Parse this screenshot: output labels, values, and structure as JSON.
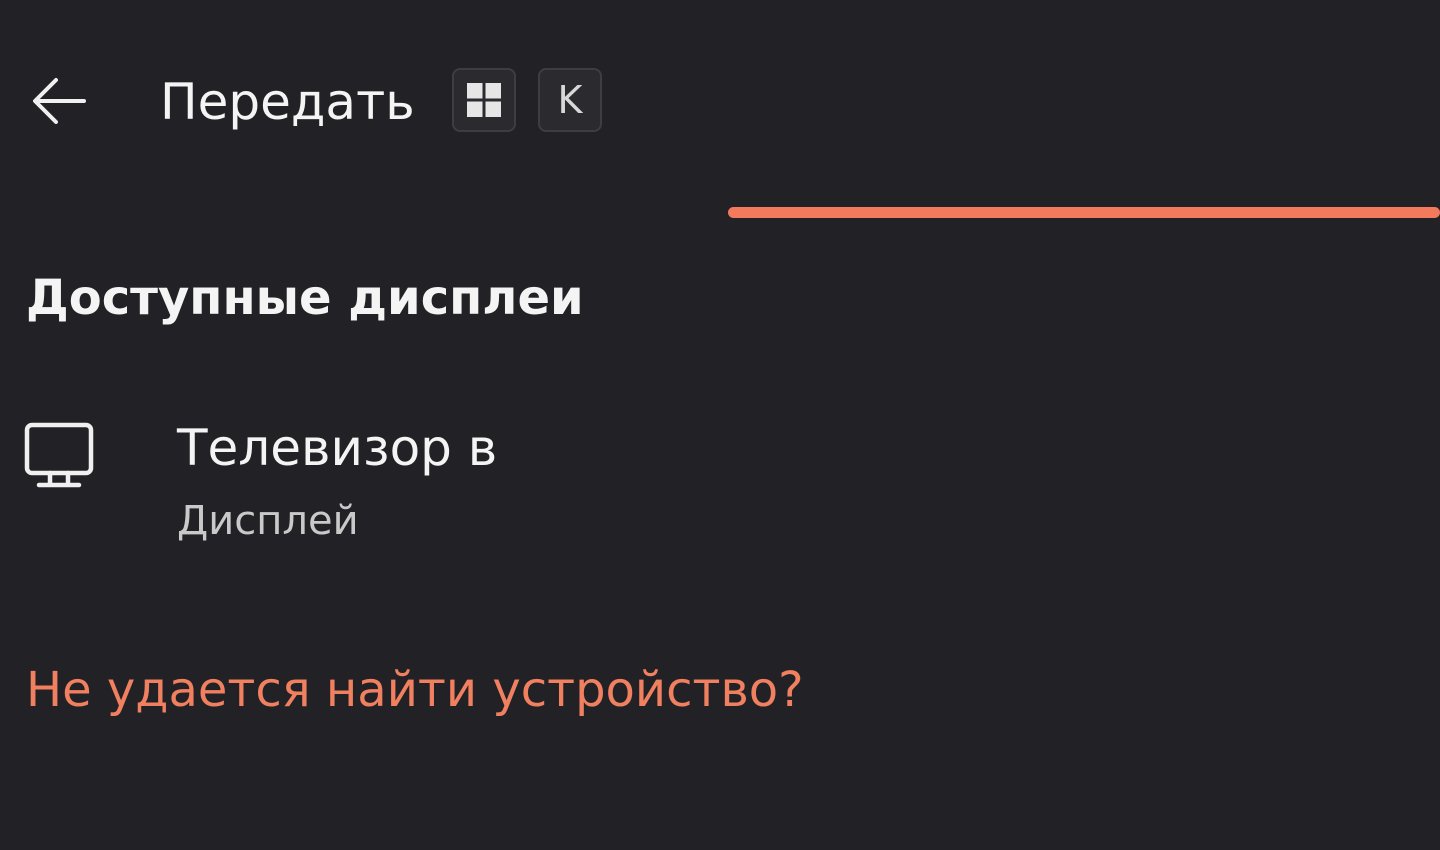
{
  "header": {
    "back_icon": "arrow-left-icon",
    "title": "Передать",
    "shortcut": {
      "win_key_icon": "windows-logo-icon",
      "key": "K"
    }
  },
  "progress": {
    "state": "indeterminate",
    "color": "#f47a5e"
  },
  "section": {
    "title": "Доступные дисплеи"
  },
  "devices": [
    {
      "icon": "monitor-icon",
      "name": "Телевизор в",
      "type": "Дисплей"
    }
  ],
  "help_link": {
    "label": "Не удается найти устройство?",
    "color": "#f0805f"
  },
  "colors": {
    "background": "#222226",
    "text": "#f4f4f4",
    "subtext": "#c9c9c9",
    "accent": "#f47a5e"
  }
}
